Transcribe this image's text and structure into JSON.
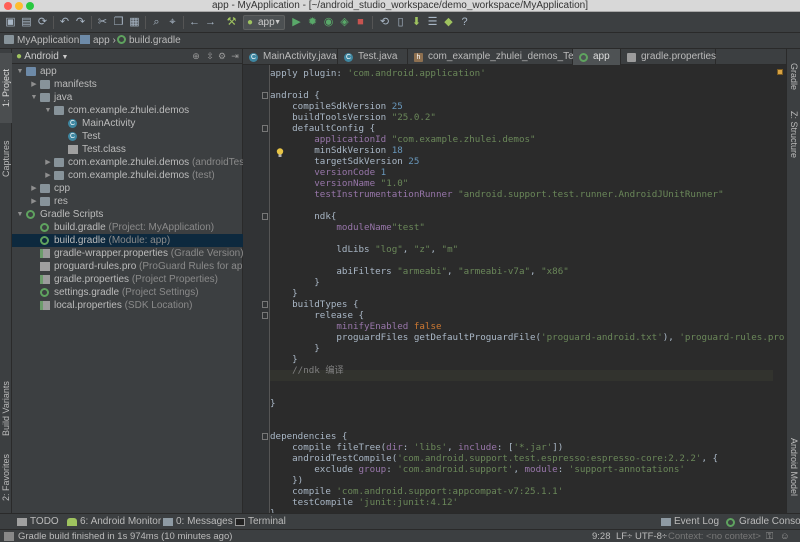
{
  "window": {
    "title": "app - MyApplication - [~/android_studio_workspace/demo_workspace/MyApplication]"
  },
  "toolbar": {
    "run_config": "app"
  },
  "breadcrumbs": [
    "MyApplication",
    "app",
    "build.gradle"
  ],
  "project_panel": {
    "view_mode": "Android",
    "tree": [
      {
        "label": "app",
        "hint": "",
        "level": 0,
        "expanded": true,
        "icon": "module-folder-icon"
      },
      {
        "label": "manifests",
        "hint": "",
        "level": 1,
        "expanded": false,
        "icon": "folder-icon"
      },
      {
        "label": "java",
        "hint": "",
        "level": 1,
        "expanded": true,
        "icon": "folder-icon"
      },
      {
        "label": "com.example.zhulei.demos",
        "hint": "",
        "level": 2,
        "expanded": true,
        "icon": "package-icon"
      },
      {
        "label": "MainActivity",
        "hint": "",
        "level": 3,
        "icon": "class-icon"
      },
      {
        "label": "Test",
        "hint": "",
        "level": 3,
        "icon": "class-icon"
      },
      {
        "label": "Test.class",
        "hint": "",
        "level": 3,
        "icon": "file-icon"
      },
      {
        "label": "com.example.zhulei.demos",
        "hint": "(androidTest)",
        "level": 2,
        "expanded": false,
        "icon": "package-icon"
      },
      {
        "label": "com.example.zhulei.demos",
        "hint": "(test)",
        "level": 2,
        "expanded": false,
        "icon": "package-icon"
      },
      {
        "label": "cpp",
        "hint": "",
        "level": 1,
        "expanded": false,
        "icon": "folder-icon"
      },
      {
        "label": "res",
        "hint": "",
        "level": 1,
        "expanded": false,
        "icon": "folder-icon"
      },
      {
        "label": "Gradle Scripts",
        "hint": "",
        "level": 0,
        "expanded": true,
        "icon": "gradle-icon"
      },
      {
        "label": "build.gradle",
        "hint": "(Project: MyApplication)",
        "level": 1,
        "icon": "gradle-icon"
      },
      {
        "label": "build.gradle",
        "hint": "(Module: app)",
        "level": 1,
        "icon": "gradle-icon",
        "selected": true
      },
      {
        "label": "gradle-wrapper.properties",
        "hint": "(Gradle Version)",
        "level": 1,
        "icon": "properties-icon"
      },
      {
        "label": "proguard-rules.pro",
        "hint": "(ProGuard Rules for app)",
        "level": 1,
        "icon": "file-icon"
      },
      {
        "label": "gradle.properties",
        "hint": "(Project Properties)",
        "level": 1,
        "icon": "properties-icon"
      },
      {
        "label": "settings.gradle",
        "hint": "(Project Settings)",
        "level": 1,
        "icon": "gradle-icon"
      },
      {
        "label": "local.properties",
        "hint": "(SDK Location)",
        "level": 1,
        "icon": "properties-icon"
      }
    ]
  },
  "editor_tabs": [
    {
      "label": "MainActivity.java",
      "icon": "class-icon",
      "active": false
    },
    {
      "label": "Test.java",
      "icon": "class-icon",
      "active": false
    },
    {
      "label": "com_example_zhulei_demos_Test.h",
      "icon": "header-icon",
      "active": false
    },
    {
      "label": "app",
      "icon": "gradle-icon",
      "active": true
    },
    {
      "label": "gradle.properties",
      "icon": "properties-icon",
      "active": false
    }
  ],
  "code_lines": [
    [
      [
        "t",
        "apply plugin: "
      ],
      [
        "s",
        "'com.android.application'"
      ]
    ],
    [],
    [
      [
        "t",
        "android {"
      ]
    ],
    [
      [
        "t",
        "    compileSdkVersion "
      ],
      [
        "n",
        "25"
      ]
    ],
    [
      [
        "t",
        "    buildToolsVersion "
      ],
      [
        "s",
        "\"25.0.2\""
      ]
    ],
    [
      [
        "t",
        "    defaultConfig {"
      ]
    ],
    [
      [
        "t",
        "        "
      ],
      [
        "p",
        "applicationId "
      ],
      [
        "s",
        "\"com.example.zhulei.demos\""
      ]
    ],
    [
      [
        "t",
        "        minSdkVersion "
      ],
      [
        "n",
        "18"
      ]
    ],
    [
      [
        "t",
        "        targetSdkVersion "
      ],
      [
        "n",
        "25"
      ]
    ],
    [
      [
        "t",
        "        "
      ],
      [
        "p",
        "versionCode "
      ],
      [
        "n",
        "1"
      ]
    ],
    [
      [
        "t",
        "        "
      ],
      [
        "p",
        "versionName "
      ],
      [
        "s",
        "\"1.0\""
      ]
    ],
    [
      [
        "t",
        "        "
      ],
      [
        "p",
        "testInstrumentationRunner "
      ],
      [
        "s",
        "\"android.support.test.runner.AndroidJUnitRunner\""
      ]
    ],
    [],
    [
      [
        "t",
        "        ndk{"
      ]
    ],
    [
      [
        "t",
        "            "
      ],
      [
        "p",
        "moduleName"
      ],
      [
        "s",
        "\"test\""
      ]
    ],
    [],
    [
      [
        "t",
        "            ldLibs "
      ],
      [
        "s",
        "\"log\""
      ],
      [
        "t",
        ", "
      ],
      [
        "s",
        "\"z\""
      ],
      [
        "t",
        ", "
      ],
      [
        "s",
        "\"m\""
      ]
    ],
    [],
    [
      [
        "t",
        "            abiFilters "
      ],
      [
        "s",
        "\"armeabi\""
      ],
      [
        "t",
        ", "
      ],
      [
        "s",
        "\"armeabi-v7a\""
      ],
      [
        "t",
        ", "
      ],
      [
        "s",
        "\"x86\""
      ]
    ],
    [
      [
        "t",
        "        }"
      ]
    ],
    [
      [
        "t",
        "    }"
      ]
    ],
    [
      [
        "t",
        "    buildTypes {"
      ]
    ],
    [
      [
        "t",
        "        release {"
      ]
    ],
    [
      [
        "t",
        "            "
      ],
      [
        "p",
        "minifyEnabled "
      ],
      [
        "k",
        "false"
      ]
    ],
    [
      [
        "t",
        "            proguardFiles getDefaultProguardFile("
      ],
      [
        "s",
        "'proguard-android.txt'"
      ],
      [
        "t",
        "), "
      ],
      [
        "s",
        "'proguard-rules.pro'"
      ]
    ],
    [
      [
        "t",
        "        }"
      ]
    ],
    [
      [
        "t",
        "    }"
      ]
    ],
    [
      [
        "c",
        "    //ndk 编译"
      ]
    ],
    [],
    [],
    [
      [
        "t",
        "}"
      ]
    ],
    [],
    [],
    [
      [
        "t",
        "dependencies {"
      ]
    ],
    [
      [
        "t",
        "    compile fileTree("
      ],
      [
        "p",
        "dir"
      ],
      [
        "t",
        ": "
      ],
      [
        "s",
        "'libs'"
      ],
      [
        "t",
        ", "
      ],
      [
        "p",
        "include"
      ],
      [
        "t",
        ": ["
      ],
      [
        "s",
        "'*.jar'"
      ],
      [
        "t",
        "])"
      ]
    ],
    [
      [
        "t",
        "    androidTestCompile("
      ],
      [
        "s",
        "'com.android.support.test.espresso:espresso-core:2.2.2'"
      ],
      [
        "t",
        ", {"
      ]
    ],
    [
      [
        "t",
        "        exclude "
      ],
      [
        "p",
        "group"
      ],
      [
        "t",
        ": "
      ],
      [
        "s",
        "'com.android.support'"
      ],
      [
        "t",
        ", "
      ],
      [
        "p",
        "module"
      ],
      [
        "t",
        ": "
      ],
      [
        "s",
        "'support-annotations'"
      ]
    ],
    [
      [
        "t",
        "    })"
      ]
    ],
    [
      [
        "t",
        "    compile "
      ],
      [
        "s",
        "'com.android.support:appcompat-v7:25.1.1'"
      ]
    ],
    [
      [
        "t",
        "    testCompile "
      ],
      [
        "s",
        "'junit:junit:4.12'"
      ]
    ],
    [
      [
        "t",
        "}"
      ]
    ]
  ],
  "left_tool_tabs": [
    "1: Project",
    "Captures",
    "Build Variants",
    "2: Favorites"
  ],
  "right_tool_tabs": [
    "Gradle",
    "Z: Structure",
    "Android Model"
  ],
  "bottom_tabs": [
    {
      "label": "TODO",
      "icon": "todo-icon"
    },
    {
      "label": "6: Android Monitor",
      "icon": "android-icon"
    },
    {
      "label": "0: Messages",
      "icon": "messages-icon"
    },
    {
      "label": "Terminal",
      "icon": "terminal-icon"
    },
    {
      "label": "Event Log",
      "icon": "event-log-icon"
    },
    {
      "label": "Gradle Console",
      "icon": "gradle-console-icon"
    }
  ],
  "status_bar": {
    "message": "Gradle build finished in 1s 974ms (10 minutes ago)",
    "position": "9:28",
    "line_separator": "LF÷",
    "encoding": "UTF-8÷",
    "context": "Context: <no context>"
  },
  "colors": {
    "background": "#2b2b2b",
    "panel": "#3c3f41",
    "selection": "#0d293e",
    "keyword": "#cc7832",
    "string": "#6a8759",
    "number": "#6897bb",
    "property": "#9876aa",
    "comment": "#808080"
  }
}
